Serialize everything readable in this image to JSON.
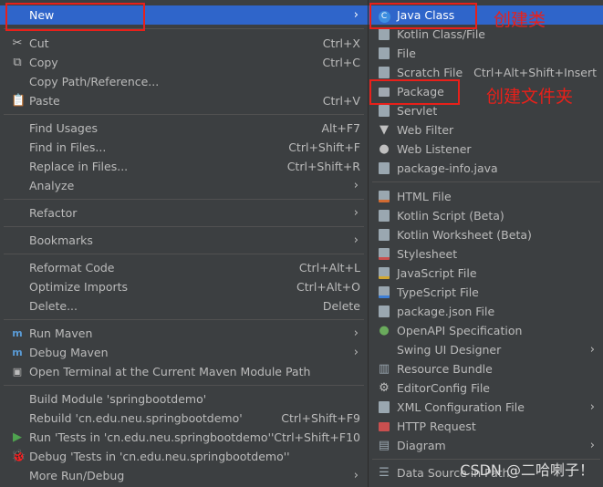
{
  "left_menu": {
    "new": "New",
    "cut": "Cut",
    "cut_sc": "Ctrl+X",
    "copy": "Copy",
    "copy_sc": "Ctrl+C",
    "copy_path": "Copy Path/Reference...",
    "paste": "Paste",
    "paste_sc": "Ctrl+V",
    "find_usages": "Find Usages",
    "find_usages_sc": "Alt+F7",
    "find_in_files": "Find in Files...",
    "find_in_files_sc": "Ctrl+Shift+F",
    "replace_in_files": "Replace in Files...",
    "replace_in_files_sc": "Ctrl+Shift+R",
    "analyze": "Analyze",
    "refactor": "Refactor",
    "bookmarks": "Bookmarks",
    "reformat": "Reformat Code",
    "reformat_sc": "Ctrl+Alt+L",
    "optimize": "Optimize Imports",
    "optimize_sc": "Ctrl+Alt+O",
    "delete": "Delete...",
    "delete_sc": "Delete",
    "run_maven": "Run Maven",
    "debug_maven": "Debug Maven",
    "open_terminal": "Open Terminal at the Current Maven Module Path",
    "build_module": "Build Module 'springbootdemo'",
    "rebuild": "Rebuild 'cn.edu.neu.springbootdemo'",
    "rebuild_sc": "Ctrl+Shift+F9",
    "run_tests": "Run 'Tests in 'cn.edu.neu.springbootdemo''",
    "run_tests_sc": "Ctrl+Shift+F10",
    "debug_tests": "Debug 'Tests in 'cn.edu.neu.springbootdemo''",
    "more_run": "More Run/Debug"
  },
  "right_menu": {
    "java_class": "Java Class",
    "kotlin_class": "Kotlin Class/File",
    "file": "File",
    "scratch": "Scratch File",
    "scratch_sc": "Ctrl+Alt+Shift+Insert",
    "package": "Package",
    "servlet": "Servlet",
    "web_filter": "Web Filter",
    "web_listener": "Web Listener",
    "package_info": "package-info.java",
    "html_file": "HTML File",
    "kotlin_script": "Kotlin Script (Beta)",
    "kotlin_worksheet": "Kotlin Worksheet (Beta)",
    "stylesheet": "Stylesheet",
    "javascript": "JavaScript File",
    "typescript": "TypeScript File",
    "package_json": "package.json File",
    "openapi": "OpenAPI Specification",
    "swing": "Swing UI Designer",
    "resource_bundle": "Resource Bundle",
    "editorconfig": "EditorConfig File",
    "xml_config": "XML Configuration File",
    "http_request": "HTTP Request",
    "diagram": "Diagram",
    "data_source": "Data Source in Path"
  },
  "annotations": {
    "create_class": "创建类",
    "create_folder": "创建文件夹"
  },
  "watermark": "CSDN @二哈喇子！",
  "colors": {
    "background": "#3c3f41",
    "selection": "#2f65ca",
    "annotation": "#e8201a"
  }
}
